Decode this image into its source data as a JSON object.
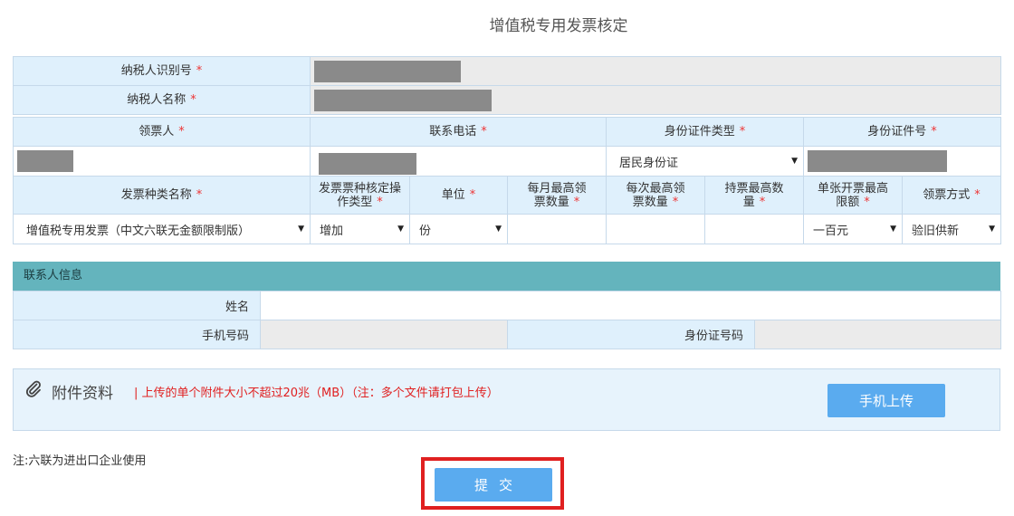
{
  "page": {
    "title": "增值税专用发票核定"
  },
  "required_mark": "*",
  "taxpayer": {
    "id_label": "纳税人识别号",
    "name_label": "纳税人名称"
  },
  "applicant": {
    "recipient_label": "领票人",
    "phone_label": "联系电话",
    "id_type_label": "身份证件类型",
    "id_number_label": "身份证件号",
    "id_type_value": "居民身份证"
  },
  "invoice": {
    "headers": {
      "type_name": "发票种类名称",
      "op_type": "发票票种核定操作类型",
      "unit": "单位",
      "monthly_max": "每月最高领票数量",
      "per_time_max": "每次最高领票数量",
      "holding_max": "持票最高数量",
      "single_limit": "单张开票最高限额",
      "method": "领票方式"
    },
    "values": {
      "type_name": "增值税专用发票（中文六联无金额限制版）",
      "op_type": "增加",
      "unit": "份",
      "single_limit": "一百元",
      "method": "验旧供新"
    }
  },
  "contact": {
    "section_title": "联系人信息",
    "name_label": "姓名",
    "mobile_label": "手机号码",
    "id_label": "身份证号码"
  },
  "attachment": {
    "title": "附件资料",
    "note": "| 上传的单个附件大小不超过20兆（MB）（注：多个文件请打包上传）",
    "mobile_upload_label": "手机上传"
  },
  "footnote": "注:六联为进出口企业使用",
  "submit_label": "提交",
  "icons": {
    "dropdown": "chevron-down-icon",
    "attachment": "paperclip-icon"
  },
  "colors": {
    "label_bg": "#dff0fc",
    "section_header_bg": "#64b4bd",
    "button_bg": "#5aabef",
    "required": "#e33333",
    "highlight": "#e02020"
  }
}
